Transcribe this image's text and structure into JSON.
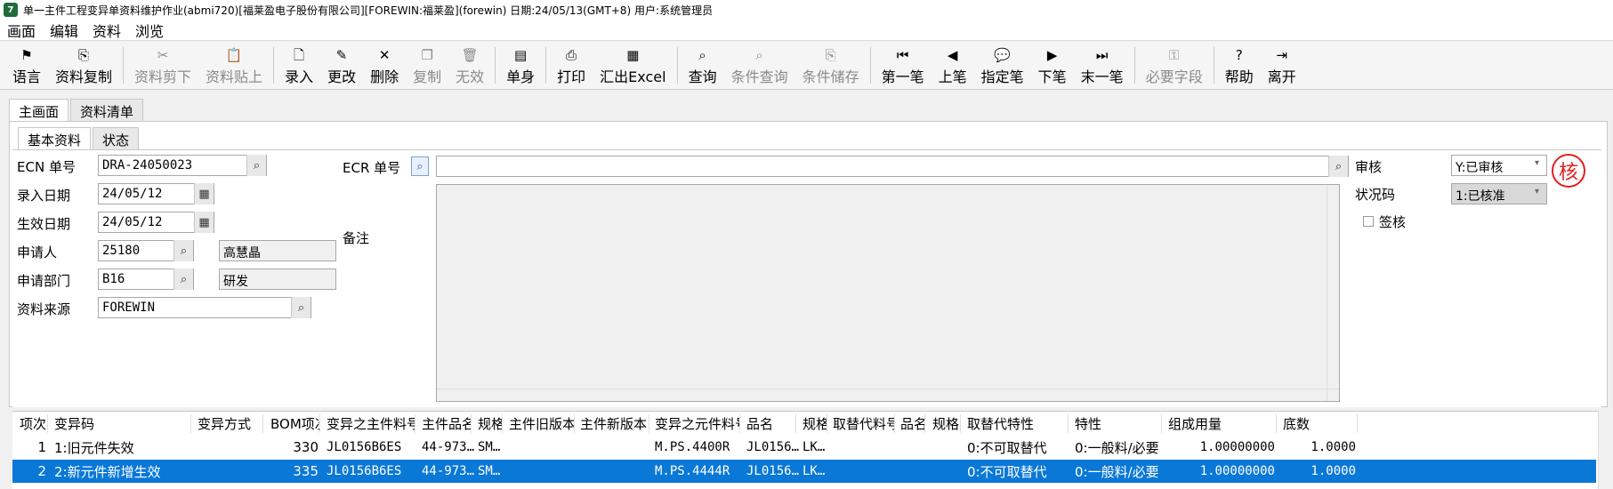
{
  "window": {
    "title": "单一主件工程变异单资料维护作业(abmi720)[福莱盈电子股份有限公司][FOREWIN:福莱盈](forewin)  日期:24/05/13(GMT+8)  用户:系统管理员"
  },
  "menu": [
    "画面",
    "编辑",
    "资料",
    "浏览"
  ],
  "toolbar": [
    {
      "label": "语言",
      "icon": "flag-icon",
      "glyph": "⚑",
      "enabled": true
    },
    {
      "label": "资料复制",
      "icon": "copy-data-icon",
      "glyph": "⎘",
      "enabled": true
    },
    {
      "label": "资料剪下",
      "icon": "scissors-icon",
      "glyph": "✂",
      "enabled": false
    },
    {
      "label": "资料贴上",
      "icon": "paste-icon",
      "glyph": "📋",
      "enabled": false
    },
    {
      "label": "录入",
      "icon": "new-doc-icon",
      "glyph": "🗋",
      "enabled": true
    },
    {
      "label": "更改",
      "icon": "pencil-icon",
      "glyph": "✎",
      "enabled": true
    },
    {
      "label": "删除",
      "icon": "x-icon",
      "glyph": "✕",
      "enabled": true
    },
    {
      "label": "复制",
      "icon": "copy-icon",
      "glyph": "❐",
      "enabled": false
    },
    {
      "label": "无效",
      "icon": "trash-icon",
      "glyph": "🗑",
      "enabled": false
    },
    {
      "label": "单身",
      "icon": "detail-icon",
      "glyph": "▤",
      "enabled": true
    },
    {
      "label": "打印",
      "icon": "printer-icon",
      "glyph": "⎙",
      "enabled": true
    },
    {
      "label": "汇出Excel",
      "icon": "excel-icon",
      "glyph": "▦",
      "enabled": true
    },
    {
      "label": "查询",
      "icon": "binoculars-icon",
      "glyph": "⌕",
      "enabled": true
    },
    {
      "label": "条件查询",
      "icon": "query-icon",
      "glyph": "⌕",
      "enabled": false
    },
    {
      "label": "条件储存",
      "icon": "save-query-icon",
      "glyph": "⎘",
      "enabled": false
    },
    {
      "label": "第一笔",
      "icon": "first-icon",
      "glyph": "⏮",
      "enabled": true
    },
    {
      "label": "上笔",
      "icon": "prev-icon",
      "glyph": "◀",
      "enabled": true
    },
    {
      "label": "指定笔",
      "icon": "speech-icon",
      "glyph": "💬",
      "enabled": true
    },
    {
      "label": "下笔",
      "icon": "next-icon",
      "glyph": "▶",
      "enabled": true
    },
    {
      "label": "末一笔",
      "icon": "last-icon",
      "glyph": "⏭",
      "enabled": true
    },
    {
      "label": "必要字段",
      "icon": "key-icon",
      "glyph": "⚿",
      "enabled": false
    },
    {
      "label": "帮助",
      "icon": "help-icon",
      "glyph": "?",
      "enabled": true
    },
    {
      "label": "离开",
      "icon": "exit-icon",
      "glyph": "⇥",
      "enabled": true
    }
  ],
  "tabs_main": [
    "主画面",
    "资料清单"
  ],
  "tabs_sub": [
    "基本资料",
    "状态"
  ],
  "form": {
    "ecn_label": "ECN 单号",
    "ecn_value": "DRA-24050023",
    "entry_date_label": "录入日期",
    "entry_date_value": "24/05/12",
    "eff_date_label": "生效日期",
    "eff_date_value": "24/05/12",
    "applicant_label": "申请人",
    "applicant_value": "25180",
    "applicant_name": "高慧晶",
    "dept_label": "申请部门",
    "dept_value": "B16",
    "dept_name": "研发",
    "source_label": "资料来源",
    "source_value": "FOREWIN",
    "ecr_label": "ECR 单号",
    "ecr_value": "",
    "memo_label": "备注",
    "memo_value": "",
    "audit_label": "审核",
    "audit_value": "Y:已审核",
    "status_label": "状况码",
    "status_value": "1:已核准",
    "sign_label": "签核",
    "sign_checked": false,
    "stamp": "核"
  },
  "grid": {
    "columns": [
      "项次",
      "变异码",
      "变异方式",
      "BOM项次",
      "变异之主件料号",
      "主件品名",
      "规格",
      "主件旧版本",
      "主件新版本",
      "变异之元件料号",
      "品名",
      "规格",
      "取替代料号",
      "品名",
      "规格",
      "取替代特性",
      "特性",
      "组成用量",
      "底数"
    ],
    "rows": [
      {
        "seq": "1",
        "code": "1:旧元件失效",
        "mode": "",
        "bom_seq": "330",
        "main_part": "JL0156B6ES",
        "main_name": "44-973…",
        "main_spec": "SM…",
        "old_ver": "",
        "new_ver": "",
        "comp_part": "M.PS.4400R",
        "comp_name": "JL0156…",
        "comp_spec": "LK…",
        "sub_part": "",
        "sub_name": "",
        "sub_spec": "",
        "sub_type": "0:不可取替代",
        "feature": "0:一般料/必要",
        "qty": "1.00000000",
        "base": "1.0000"
      },
      {
        "seq": "2",
        "code": "2:新元件新增生效",
        "mode": "",
        "bom_seq": "335",
        "main_part": "JL0156B6ES",
        "main_name": "44-973…",
        "main_spec": "SM…",
        "old_ver": "",
        "new_ver": "",
        "comp_part": "M.PS.4444R",
        "comp_name": "JL0156…",
        "comp_spec": "LK…",
        "sub_part": "",
        "sub_name": "",
        "sub_spec": "",
        "sub_type": "0:不可取替代",
        "feature": "0:一般料/必要",
        "qty": "1.00000000",
        "base": "1.0000"
      }
    ]
  }
}
